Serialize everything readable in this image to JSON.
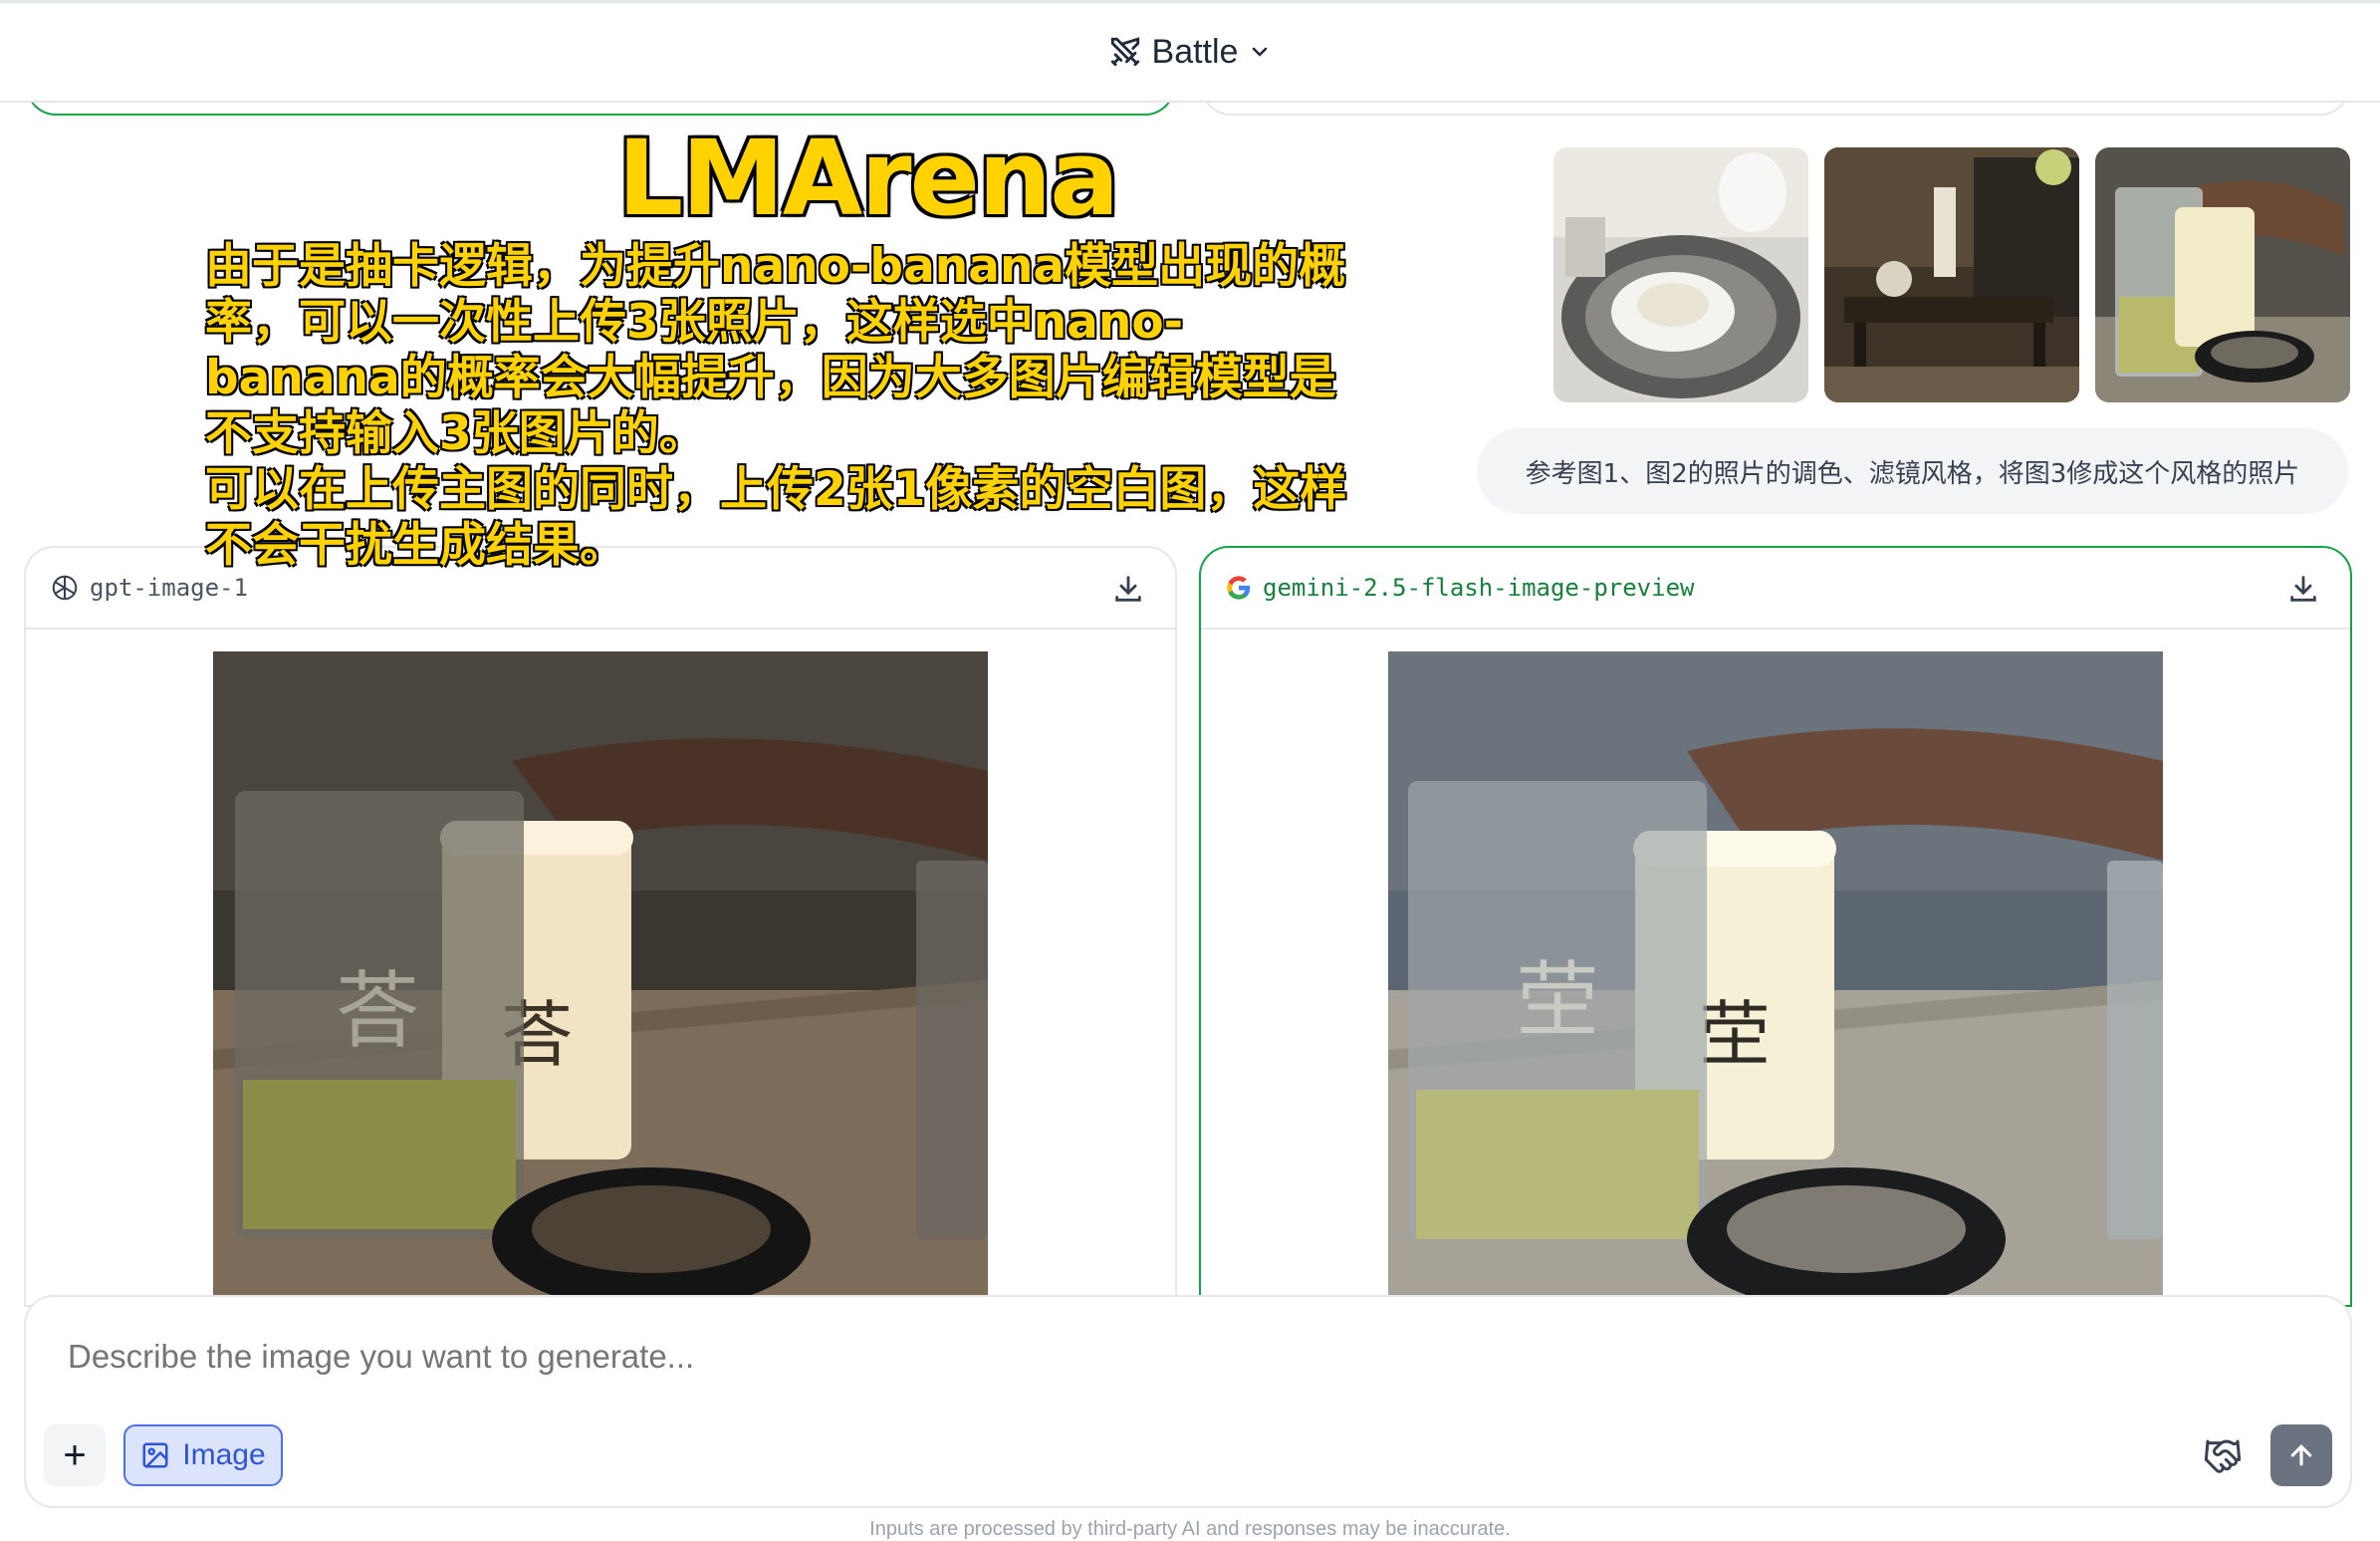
{
  "header": {
    "mode_label": "Battle"
  },
  "reference_images": [
    "restaurant-teacup-photo",
    "teahouse-table-photo",
    "glass-and-lamp-photo"
  ],
  "user_prompt": "参考图1、图2的照片的调色、滤镜风格，将图3修成这个风格的照片",
  "overlay": {
    "title": "LMArena",
    "lines": [
      "由于是抽卡逻辑，为提升nano-banana模型出现的概率，可以一次性上传3张照片，这样选中nano-banana的概率会大幅提升，因为大多图片编辑模型是不支持输入3张图片的。",
      "可以在上传主图的同时，上传2张1像素的空白图，这样不会干扰生成结果。"
    ]
  },
  "responses": [
    {
      "model": "gpt-image-1",
      "download_label": "download"
    },
    {
      "model": "gemini-2.5-flash-image-preview",
      "download_label": "download"
    }
  ],
  "composer": {
    "placeholder": "Describe the image you want to generate...",
    "image_button_label": "Image",
    "plus_label": "+"
  },
  "disclaimer": "Inputs are processed by third-party AI and responses may be inaccurate.",
  "colors": {
    "accent_green": "#16a34a",
    "image_button_blue": "#2f54d6",
    "overlay_yellow": "#ffd200"
  }
}
